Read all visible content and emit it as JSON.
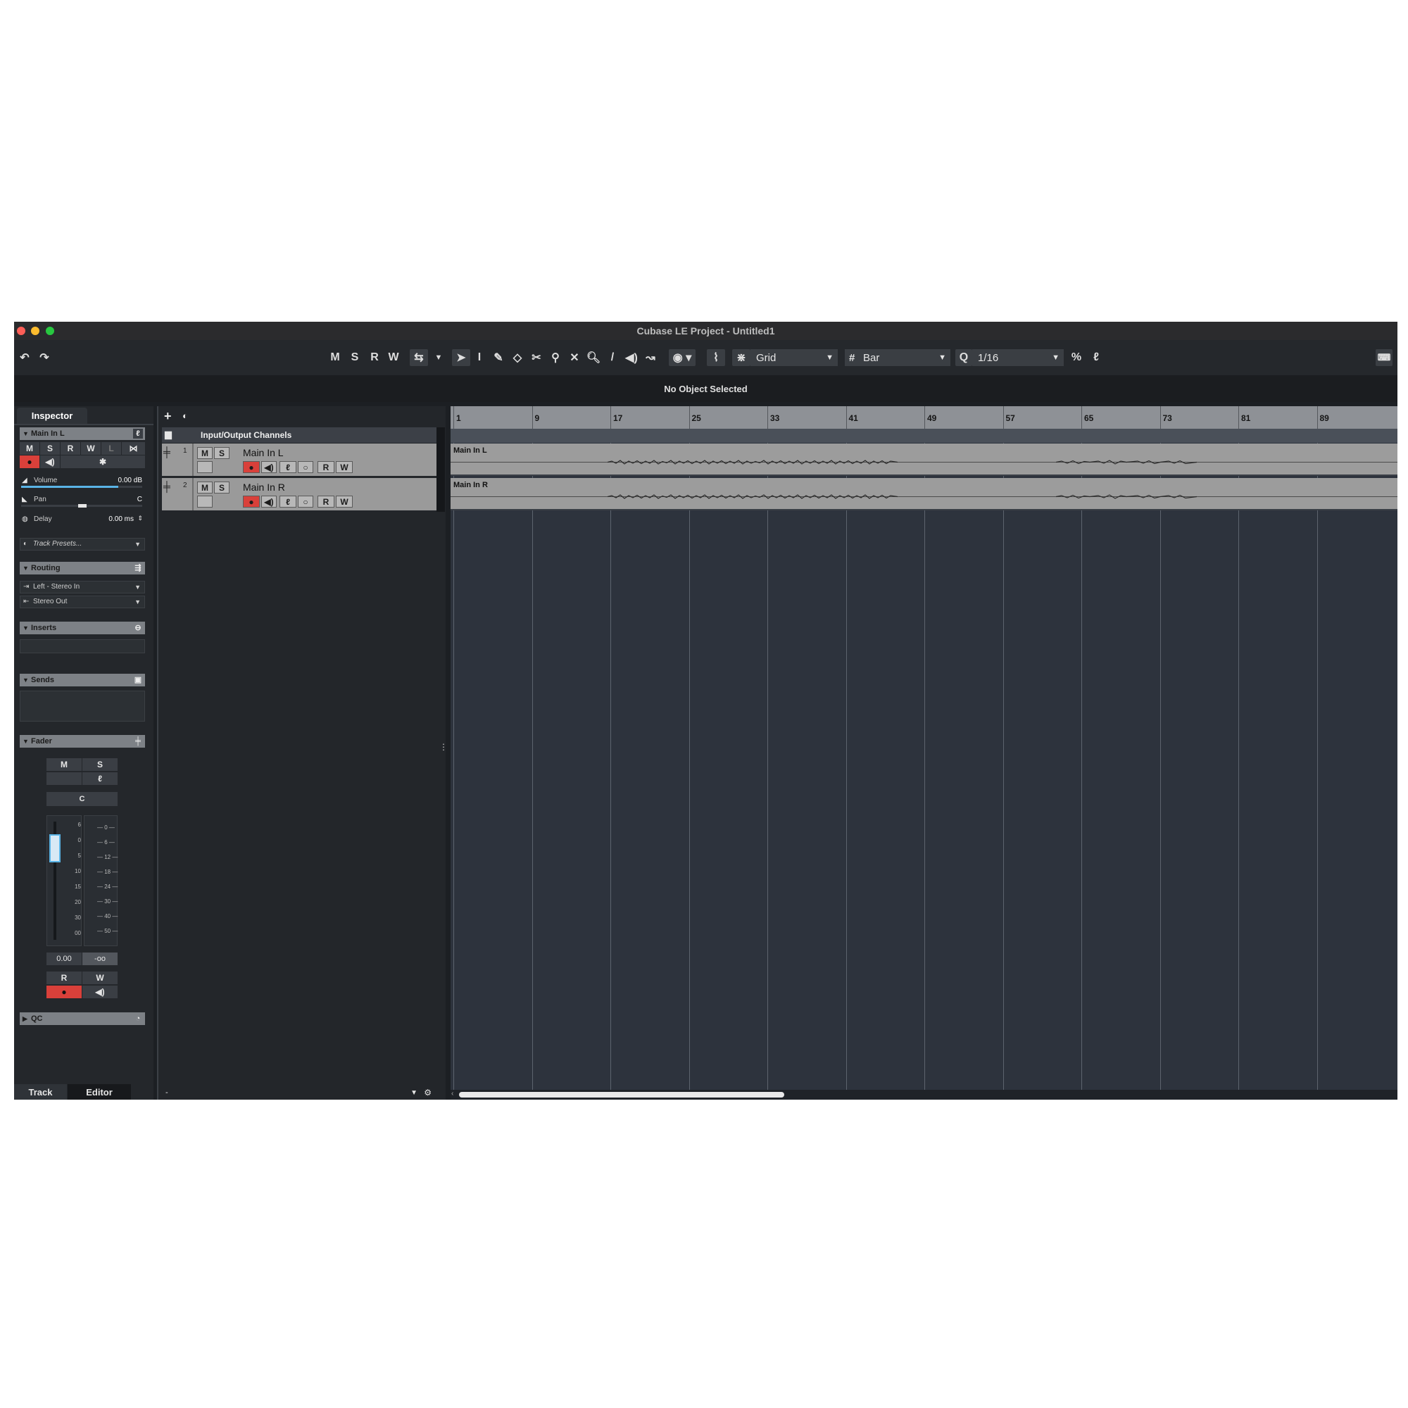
{
  "window": {
    "title": "Cubase LE Project - Untitled1"
  },
  "toolbar": {
    "track_buttons": [
      "M",
      "S",
      "R",
      "W"
    ],
    "snap_type": "Grid",
    "grid_type": "Bar",
    "quantize": "1/16"
  },
  "info_line": "No Object Selected",
  "inspector": {
    "tab": "Inspector",
    "track_name": "Main In L",
    "buttons": [
      "M",
      "S",
      "R",
      "W",
      "L"
    ],
    "volume_label": "Volume",
    "volume_value": "0.00 dB",
    "pan_label": "Pan",
    "pan_value": "C",
    "delay_label": "Delay",
    "delay_value": "0.00 ms",
    "track_presets": "Track Presets...",
    "sections": {
      "routing": "Routing",
      "inserts": "Inserts",
      "sends": "Sends",
      "fader": "Fader",
      "qc": "QC"
    },
    "routing_in": "Left - Stereo In",
    "routing_out": "Stereo Out",
    "fader": {
      "m": "M",
      "s": "S",
      "pan": "C",
      "left_scale": [
        "6",
        "0",
        "5",
        "10",
        "15",
        "20",
        "30",
        "00"
      ],
      "right_scale": [
        "0",
        "6",
        "12",
        "18",
        "24",
        "30",
        "40",
        "50"
      ],
      "value": "0.00",
      "peak": "-oo",
      "r": "R",
      "w": "W",
      "level": 0.82
    },
    "bottom_tabs": [
      "Track",
      "Editor"
    ]
  },
  "tracklist": {
    "folder": "Input/Output Channels",
    "tracks": [
      {
        "number": "1",
        "name": "Main In L",
        "m": "M",
        "s": "S",
        "r": "R",
        "w": "W"
      },
      {
        "number": "2",
        "name": "Main In R",
        "m": "M",
        "s": "S",
        "r": "R",
        "w": "W"
      }
    ],
    "bottom_left": "-"
  },
  "arrange": {
    "bars": [
      "1",
      "9",
      "17",
      "25",
      "33",
      "41",
      "49",
      "57",
      "65",
      "73",
      "81",
      "89"
    ],
    "events": [
      {
        "name": "Main In L"
      },
      {
        "name": "Main In R"
      }
    ]
  },
  "colors": {
    "record": "#d9403a",
    "close": "#ff5f57",
    "minimize": "#febc2e",
    "zoom": "#28c840",
    "fader_accent": "#5ab4e6"
  }
}
